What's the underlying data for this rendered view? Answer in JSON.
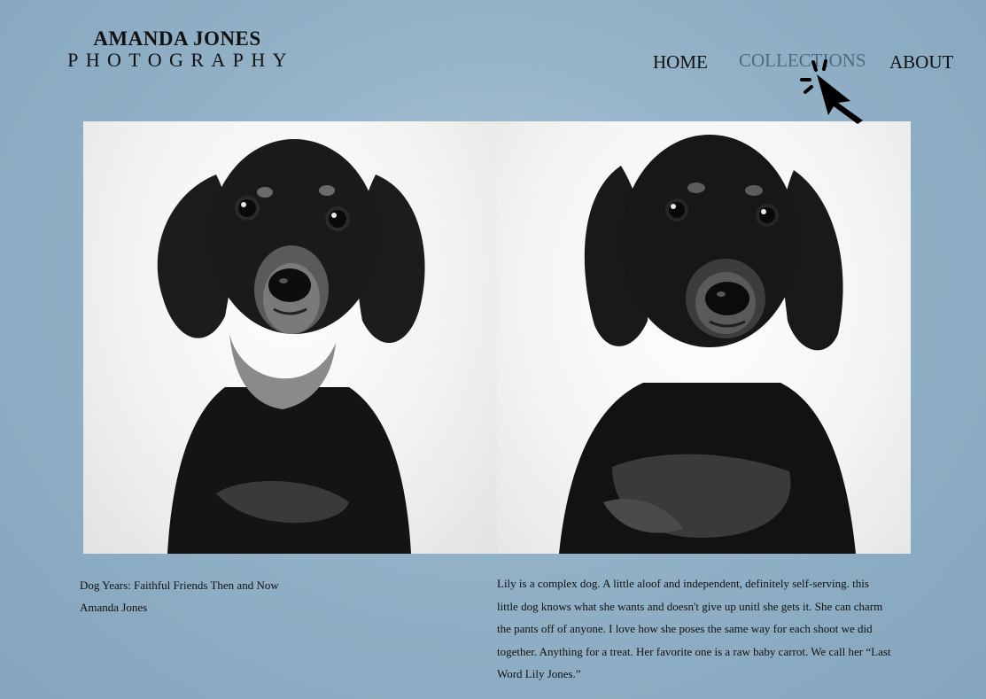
{
  "logo": {
    "name": "AMANDA JONES",
    "subtitle": "PHOTOGRAPHY"
  },
  "nav": {
    "home": "HOME",
    "collections": "COLLECTIONS",
    "about": "ABOUT"
  },
  "photos": [
    {
      "icon": "dachshund-photo-left"
    },
    {
      "icon": "dachshund-photo-right"
    }
  ],
  "caption": {
    "title": "Dog Years: Faithful Friends Then and Now",
    "author": "Amanda Jones"
  },
  "story": {
    "lines": [
      "Lily is a complex dog. A little aloof and independent, definitely self-serving. this",
      "little dog knows what she wants and doesn't give up unitl she gets it. She can charm",
      "the pants off of anyone. I love how she poses the same way for each shoot we did",
      "together. Anything for a treat. Her favorite one is a raw baby carrot. We call her “Last",
      "Word Lily Jones.”"
    ]
  },
  "colors": {
    "background": "#93b2c8",
    "nav_active": "#4f6a7e",
    "text": "#111111"
  },
  "cursor": {
    "icon": "pointer-click-icon"
  }
}
